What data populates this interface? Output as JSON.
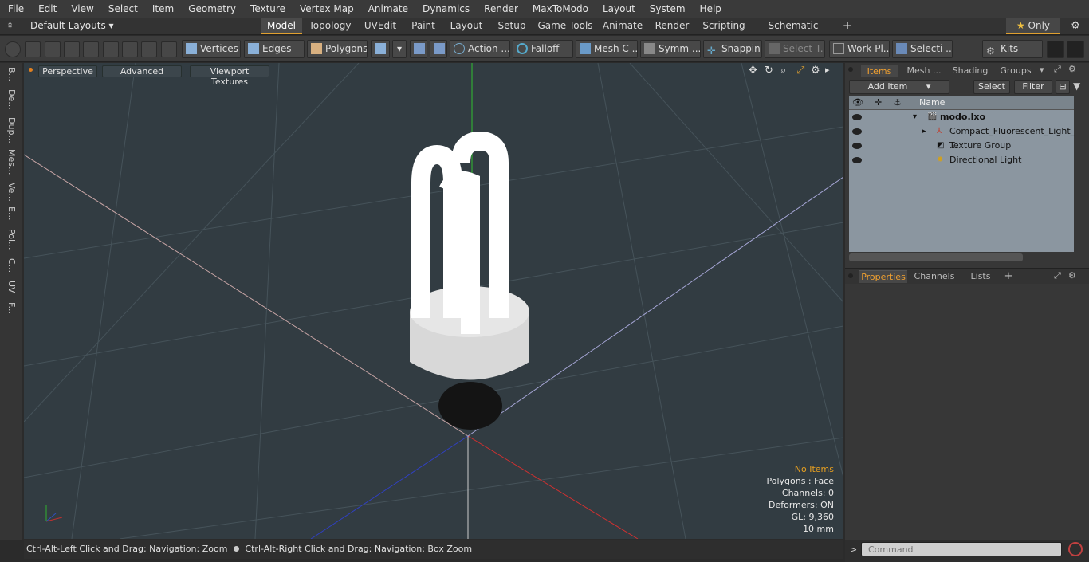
{
  "menu": [
    "File",
    "Edit",
    "View",
    "Select",
    "Item",
    "Geometry",
    "Texture",
    "Vertex Map",
    "Animate",
    "Dynamics",
    "Render",
    "MaxToModo",
    "Layout",
    "System",
    "Help"
  ],
  "layout": {
    "preset": "Default Layouts",
    "tabs": [
      "Model",
      "Topology",
      "UVEdit",
      "Paint",
      "Layout",
      "Setup",
      "Game Tools",
      "Animate",
      "Render",
      "Scripting",
      "Schematic Fusion"
    ],
    "active_tab": "Model",
    "add": "+",
    "only_label": "Only"
  },
  "toolbar": {
    "vertices": "Vertices",
    "edges": "Edges",
    "polygons": "Polygons",
    "action": "Action ...",
    "falloff": "Falloff",
    "mesh": "Mesh C ...",
    "symm": "Symm ...",
    "snapping": "Snapping",
    "select_t": "Select T...",
    "work_pl": "Work Pl...",
    "selecti": "Selecti ...",
    "kits": "Kits"
  },
  "left_tabs": [
    "B...",
    "De...",
    "Dup...",
    "Mes...",
    "Ve...",
    "E...",
    "Pol...",
    "C...",
    "UV",
    "F..."
  ],
  "viewport": {
    "perspective": "Perspective",
    "advanced": "Advanced",
    "textures": "Viewport Textures",
    "info": [
      "No Items",
      "Polygons : Face",
      "Channels: 0",
      "Deformers: ON",
      "GL: 9,360",
      "10 mm"
    ],
    "info_accent": "#e8a020",
    "bg_color": "#323c42"
  },
  "status": {
    "text1": "Ctrl-Alt-Left Click and Drag: Navigation: Zoom",
    "text2": "Ctrl-Alt-Right Click and Drag: Navigation: Box Zoom"
  },
  "items_panel": {
    "tabs": [
      "Items",
      "Mesh ...",
      "Shading",
      "Groups"
    ],
    "active": "Items",
    "add_item": "Add Item",
    "select": "Select",
    "filter": "Filter",
    "col_name": "Name",
    "rows": [
      {
        "label": "modo.lxo",
        "icon": "scene-icon"
      },
      {
        "label": "Compact_Fluorescent_Light_ ...",
        "icon": "mesh-icon"
      },
      {
        "label": "Texture Group",
        "icon": "texture-icon"
      },
      {
        "label": "Directional Light",
        "icon": "light-icon"
      }
    ]
  },
  "props_panel": {
    "tabs": [
      "Properties",
      "Channels",
      "Lists"
    ],
    "active": "Properties",
    "add": "+"
  },
  "command": {
    "placeholder": "Command"
  }
}
